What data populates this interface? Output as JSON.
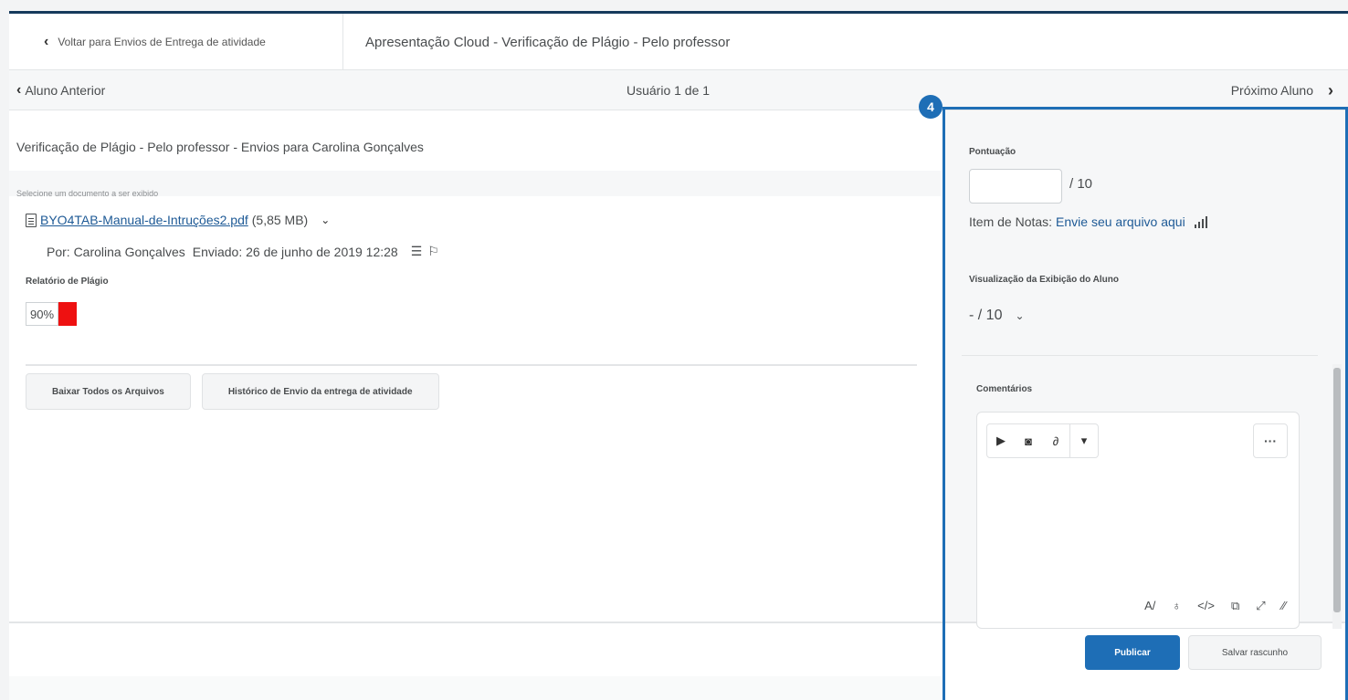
{
  "header": {
    "back_label": "Voltar para Envios de Entrega de atividade",
    "title": "Apresentação Cloud - Verificação de Plágio - Pelo professor"
  },
  "nav": {
    "prev_label": "Aluno Anterior",
    "user_count": "Usuário 1 de 1",
    "next_label": "Próximo Aluno"
  },
  "main": {
    "subtitle": "Verificação de Plágio - Pelo professor - Envios para Carolina Gonçalves",
    "select_doc_label": "Selecione um documento a ser exibido",
    "file_name": "BYO4TAB-Manual-de-Intruções2.pdf",
    "file_size": "(5,85 MB)",
    "submitted_by": "Por: Carolina Gonçalves",
    "submitted_at": "Enviado: 26 de junho de 2019 12:28",
    "report_label": "Relatório de Plágio",
    "report_score": "90%",
    "report_color": "#ee1111",
    "download_all_label": "Baixar Todos os Arquivos",
    "history_label": "Histórico de Envio da entrega de atividade"
  },
  "grading": {
    "score_label": "Pontuação",
    "score_value": "",
    "out_of": "/ 10",
    "grade_item_prefix": "Item de Notas:",
    "grade_item_link": "Envie seu arquivo aqui",
    "preview_label": "Visualização da Exibição do Aluno",
    "preview_value": "- / 10",
    "comments_label": "Comentários",
    "publish_label": "Publicar",
    "save_draft_label": "Salvar rascunho"
  },
  "callout": {
    "number": "4",
    "color": "#1e6eb6"
  }
}
